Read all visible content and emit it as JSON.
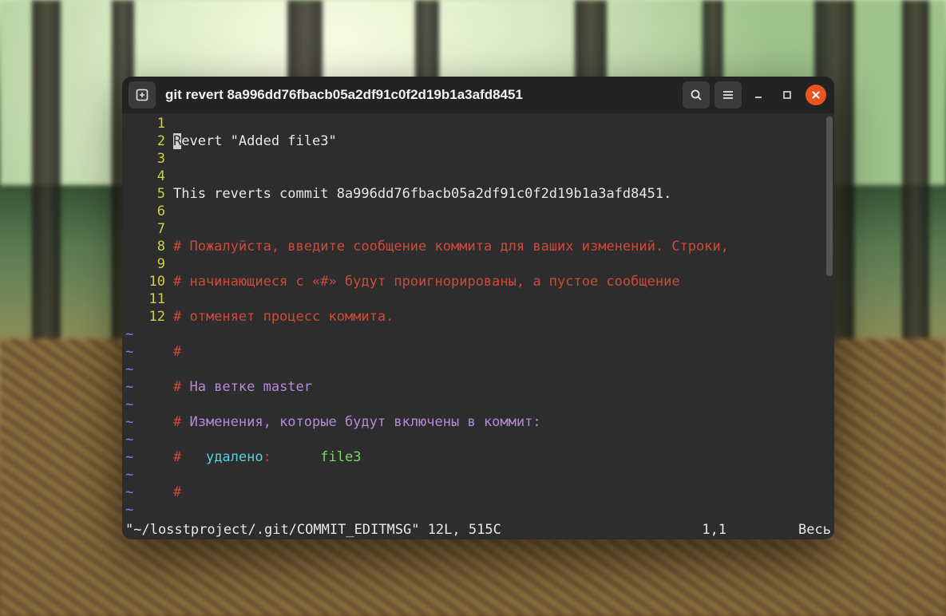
{
  "window": {
    "title": "git revert 8a996dd76fbacb05a2df91c0f2d19b1a3afd8451"
  },
  "editor": {
    "line_numbers": [
      "1",
      "2",
      "3",
      "4",
      "5",
      "6",
      "7",
      "8",
      "9",
      "10",
      "11",
      "12"
    ],
    "lines": {
      "l1_cursor_char": "R",
      "l1_rest": "evert \"Added file3\"",
      "l2": "",
      "l3": "This reverts commit 8a996dd76fbacb05a2df91c0f2d19b1a3afd8451.",
      "l4": "",
      "l5": "# Пожалуйста, введите сообщение коммита для ваших изменений. Строки,",
      "l6": "# начинающиеся с «#» будут проигнорированы, а пустое сообщение",
      "l7": "# отменяет процесс коммита.",
      "l8": "#",
      "l9_hash": "#",
      "l9_rest": " На ветке master",
      "l10_hash": "#",
      "l10_rest": " Изменения, которые будут включены в коммит:",
      "l11_hash": "#",
      "l11_label": "   удалено",
      "l11_colon": ":",
      "l11_file": "      file3",
      "l12": "#"
    },
    "tilde": "~"
  },
  "status": {
    "file": "\"~/losstproject/.git/COMMIT_EDITMSG\" 12L, 515C",
    "pos": "1,1",
    "mode": "Весь"
  },
  "icons": {
    "newtab": "new-tab-icon",
    "search": "search-icon",
    "menu": "hamburger-icon",
    "minimize": "minimize-icon",
    "maximize": "maximize-icon",
    "close": "close-icon"
  }
}
